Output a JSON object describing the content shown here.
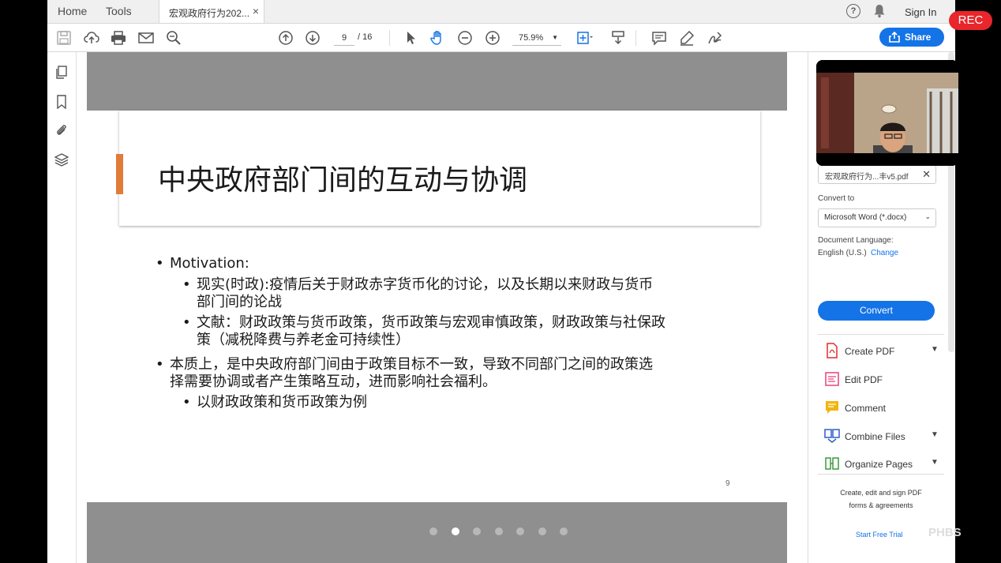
{
  "tabbar": {
    "home": "Home",
    "tools": "Tools",
    "doc_tab": "宏观政府行为202...",
    "close": "×",
    "help": "?",
    "sign_in": "Sign In"
  },
  "toolbar": {
    "page_current": "9",
    "page_total": "/ 16",
    "zoom": "75.9%",
    "share": "Share"
  },
  "slide": {
    "title": "中央政府部门间的互动与协调",
    "bullets": [
      {
        "level": 1,
        "lines": [
          "Motivation:"
        ]
      },
      {
        "level": 2,
        "lines": [
          "现实(时政):疫情后关于财政赤字货币化的讨论，以及长期以来财政与货币",
          "部门间的论战"
        ]
      },
      {
        "level": 2,
        "lines": [
          "文献：财政政策与货币政策，货币政策与宏观审慎政策，财政政策与社保政",
          "策（减税降费与养老金可持续性）"
        ]
      },
      {
        "level": 1,
        "lines": [
          "本质上，是中央政府部门间由于政策目标不一致，导致不同部门之间的政策选",
          "择需要协调或者产生策略互动，进而影响社会福利。"
        ]
      },
      {
        "level": 2,
        "lines": [
          "以财政政策和货币政策为例"
        ]
      }
    ],
    "page_number": "9",
    "carousel_active": 1
  },
  "right_pane": {
    "file_name": "宏观政府行为...丰v5.pdf",
    "convert_to_label": "Convert to",
    "convert_to_value": "Microsoft Word (*.docx)",
    "doc_language_label": "Document Language:",
    "doc_language_value": "English (U.S.)",
    "change": "Change",
    "convert_button": "Convert",
    "tools": [
      "Create PDF",
      "Edit PDF",
      "Comment",
      "Combine Files",
      "Organize Pages"
    ],
    "promo_line1": "Create, edit and sign PDF",
    "promo_line2": "forms & agreements",
    "trial": "Start Free Trial"
  },
  "overlay": {
    "rec": "REC",
    "watermark": "PHBS"
  }
}
